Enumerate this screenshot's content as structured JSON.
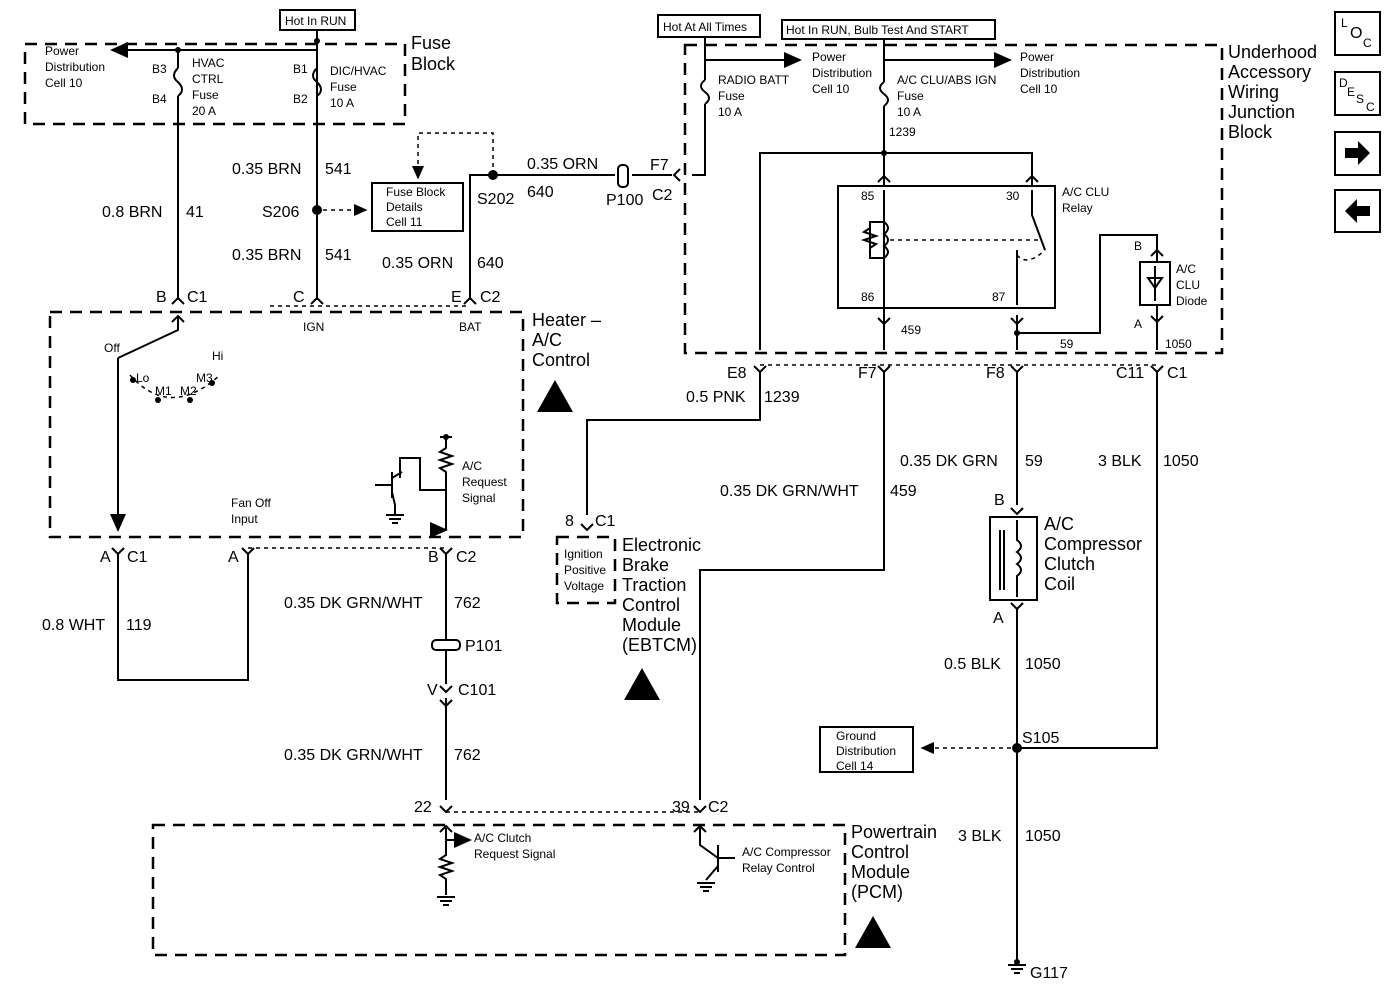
{
  "power_labels": {
    "hot_in_run": "Hot In RUN",
    "hot_at_all_times": "Hot At All Times",
    "hot_run_bulb_start": "Hot In RUN, Bulb Test And START"
  },
  "fuse_block": {
    "title_1": "Fuse",
    "title_2": "Block",
    "power_dist": [
      "Power",
      "Distribution",
      "Cell 10"
    ],
    "b3": "B3",
    "b4": "B4",
    "b1": "B1",
    "b2": "B2",
    "hvac_fuse": [
      "HVAC",
      "CTRL",
      "Fuse",
      "20 A"
    ],
    "dic_fuse": [
      "DIC/HVAC",
      "Fuse",
      "10 A"
    ]
  },
  "wires": {
    "w541a_color": "0.35 BRN",
    "w541a_num": "541",
    "w41_color": "0.8 BRN",
    "w41_num": "41",
    "w541b_color": "0.35 BRN",
    "w541b_num": "541",
    "w640a_color": "0.35 ORN",
    "w640a_num": "640",
    "w640b_color": "0.35 ORN",
    "w640b_num": "640",
    "w119_color": "0.8 WHT",
    "w119_num": "119",
    "w762a_color": "0.35 DK GRN/WHT",
    "w762a_num": "762",
    "w762b_color": "0.35 DK GRN/WHT",
    "w762b_num": "762",
    "w1239_color": "0.5 PNK",
    "w1239_num": "1239",
    "w459_color": "0.35 DK GRN/WHT",
    "w459_num": "459",
    "w59_color": "0.35 DK GRN",
    "w59_num": "59",
    "w1050a_color": "3 BLK",
    "w1050a_num": "1050",
    "w1050b_color": "0.5 BLK",
    "w1050b_num": "1050",
    "w1050c_color": "3 BLK",
    "w1050c_num": "1050"
  },
  "splices": {
    "s206": "S206",
    "s202": "S202",
    "s105": "S105",
    "p100": "P100",
    "p101": "P101",
    "g117": "G117"
  },
  "ref_boxes": {
    "fuse_details": [
      "Fuse Block",
      "Details",
      "Cell 11"
    ],
    "ground_dist": [
      "Ground",
      "Distribution",
      "Cell 14"
    ]
  },
  "connectors": {
    "f7": "F7",
    "c2_p100": "C2",
    "b": "B",
    "c1": "C1",
    "c": "C",
    "e": "E",
    "c2": "C2",
    "ign": "IGN",
    "bat": "BAT",
    "a1": "A",
    "c1b": "C1",
    "a2": "A",
    "b2": "B",
    "c2b": "C2",
    "v": "V",
    "c101": "C101",
    "p22": "22",
    "p39": "39",
    "c2pcm": "C2",
    "e8": "E8",
    "f7b": "F7",
    "f8": "F8",
    "c11": "C11",
    "c1j": "C1",
    "p8": "8",
    "c1e": "C1",
    "comp_b": "B",
    "comp_a": "A"
  },
  "heater_control": {
    "title": [
      "Heater –",
      "A/C",
      "Control"
    ],
    "off": "Off",
    "lo": "Lo",
    "m1": "M1",
    "m2": "M2",
    "m3": "M3",
    "hi": "Hi",
    "fan_off": [
      "Fan Off",
      "Input"
    ],
    "ac_request": [
      "A/C",
      "Request",
      "Signal"
    ]
  },
  "junction_block": {
    "title": [
      "Underhood",
      "Accessory",
      "Wiring",
      "Junction",
      "Block"
    ],
    "radio_fuse": [
      "RADIO BATT",
      "Fuse",
      "10 A"
    ],
    "pd_1": [
      "Power",
      "Distribution",
      "Cell 10"
    ],
    "clu_fuse": [
      "A/C CLU/ABS IGN",
      "Fuse",
      "10 A"
    ],
    "pd_2": [
      "Power",
      "Distribution",
      "Cell 10"
    ],
    "n1239": "1239",
    "relay": [
      "A/C CLU",
      "Relay"
    ],
    "p85": "85",
    "p30": "30",
    "p86": "86",
    "p87": "87",
    "n459": "459",
    "n59": "59",
    "n1050": "1050",
    "diode": [
      "A/C",
      "CLU",
      "Diode"
    ],
    "diode_b": "B",
    "diode_a": "A"
  },
  "ebtcm": {
    "inner": [
      "Ignition",
      "Positive",
      "Voltage"
    ],
    "title": [
      "Electronic",
      "Brake",
      "Traction",
      "Control",
      "Module",
      "(EBTCM)"
    ]
  },
  "compressor": {
    "title": [
      "A/C",
      "Compressor",
      "Clutch",
      "Coil"
    ]
  },
  "pcm": {
    "title": [
      "Powertrain",
      "Control",
      "Module",
      "(PCM)"
    ],
    "clutch_req": [
      "A/C Clutch",
      "Request Signal"
    ],
    "relay_ctrl": [
      "A/C Compressor",
      "Relay Control"
    ]
  },
  "nav": {
    "loc": [
      "L",
      "O",
      "C"
    ],
    "desc": [
      "D",
      "E",
      "S",
      "C"
    ],
    "next_icon": "right-arrow",
    "prev_icon": "left-arrow"
  }
}
